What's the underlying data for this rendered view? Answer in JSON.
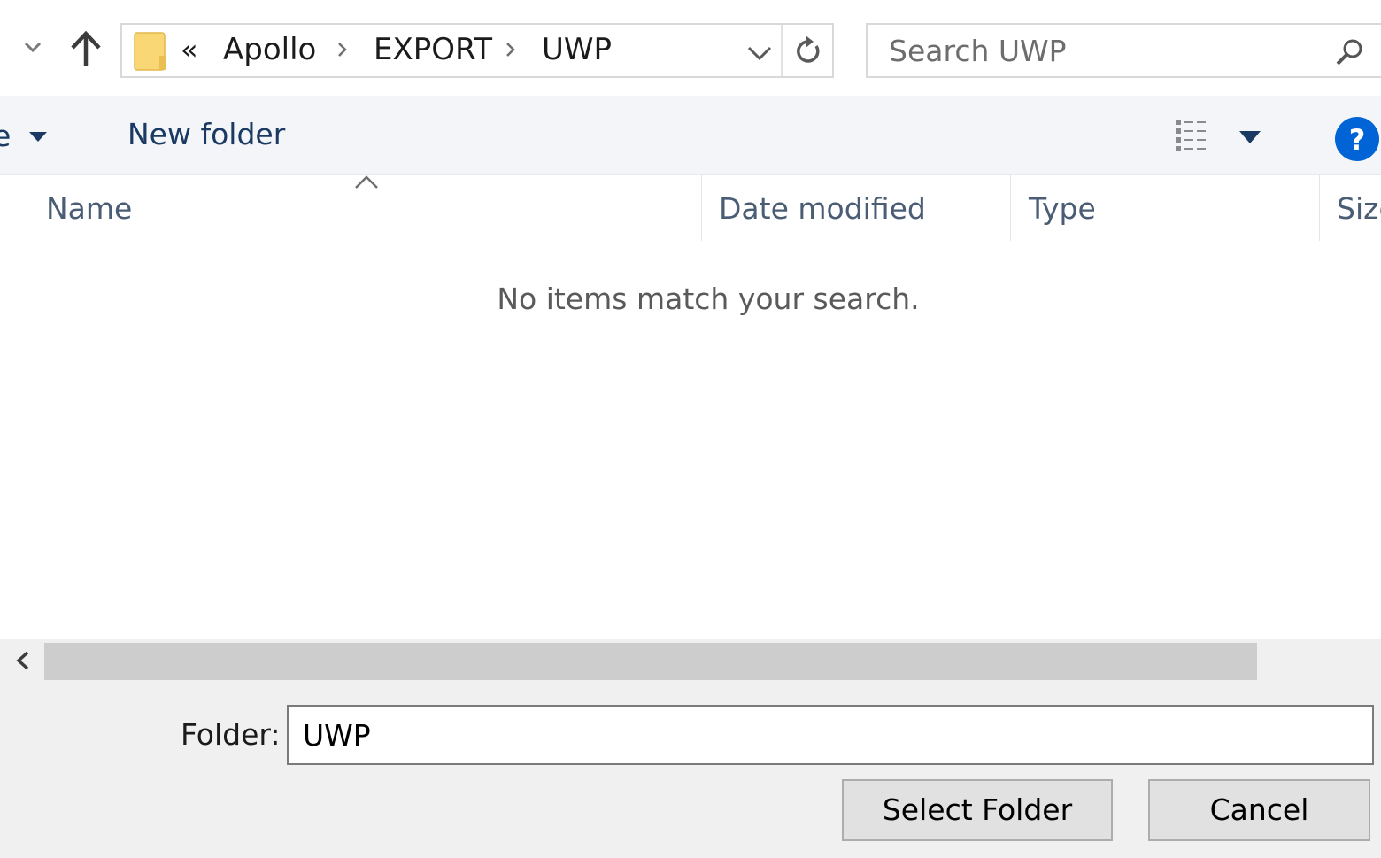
{
  "address_bar": {
    "overflow": "«",
    "crumbs": [
      "Apollo",
      "EXPORT",
      "UWP"
    ]
  },
  "search": {
    "placeholder": "Search UWP"
  },
  "toolbar": {
    "organize_label": "e",
    "new_folder_label": "New folder"
  },
  "file_list": {
    "columns": [
      "Name",
      "Date modified",
      "Type",
      "Size"
    ],
    "empty_message": "No items match your search."
  },
  "folder_field": {
    "label": "Folder:",
    "value": "UWP"
  },
  "buttons": {
    "select": "Select Folder",
    "cancel": "Cancel"
  },
  "icons": {
    "recent": "chevron-down-icon",
    "up": "up-arrow-icon",
    "folder": "folder-icon",
    "refresh": "refresh-icon",
    "search": "search-icon",
    "view": "details-view-icon",
    "help": "help-icon"
  },
  "colors": {
    "help_blue": "#0063d6",
    "folder_yellow": "#f9d775"
  }
}
